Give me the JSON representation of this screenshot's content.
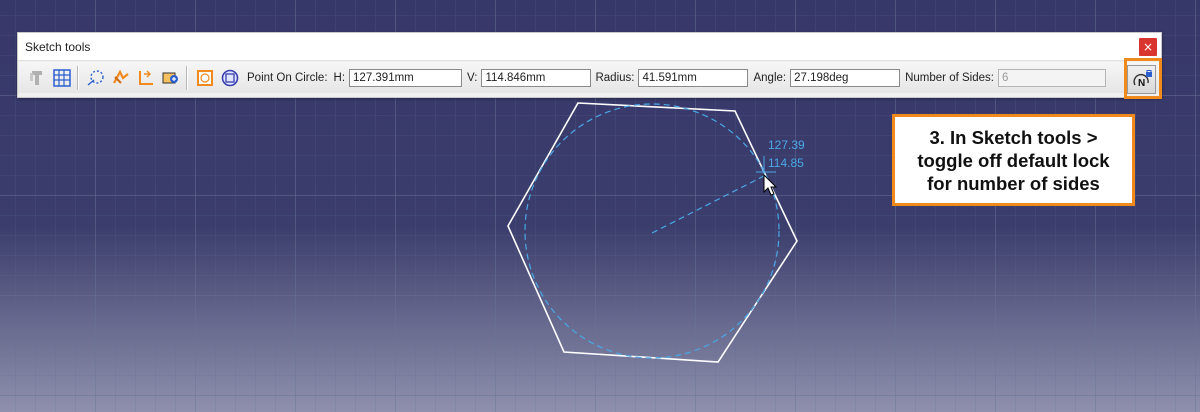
{
  "toolbar": {
    "title": "Sketch tools",
    "close_icon": "×",
    "point_on_circle_label": "Point On Circle:",
    "h_label": "H:",
    "h_value": "127.391mm",
    "v_label": "V:",
    "v_value": "114.846mm",
    "radius_label": "Radius:",
    "radius_value": "41.591mm",
    "angle_label": "Angle:",
    "angle_value": "27.198deg",
    "sides_label": "Number of Sides:",
    "sides_value": "6",
    "icons": [
      "snap-to-point-icon",
      "grid-icon",
      "construction-element-icon",
      "geometric-constraints-icon",
      "dimensional-constraints-icon",
      "auto-dimension-icon",
      "circumscribed-polygon-icon",
      "inscribed-polygon-icon",
      "number-of-sides-lock-icon"
    ],
    "lock_icon_letter": "N"
  },
  "canvas": {
    "coord_h": "127.39",
    "coord_v": "114.85"
  },
  "callout": {
    "text": "3. In Sketch tools >\ntoggle off default lock\nfor number of sides"
  },
  "colors": {
    "background_top": "#37386a",
    "background_bottom": "#8e90ad",
    "accent_orange": "#f08a1c",
    "close_red": "#d9352f",
    "construction_blue": "#4aa8e6",
    "sketch_white": "#ffffff"
  }
}
